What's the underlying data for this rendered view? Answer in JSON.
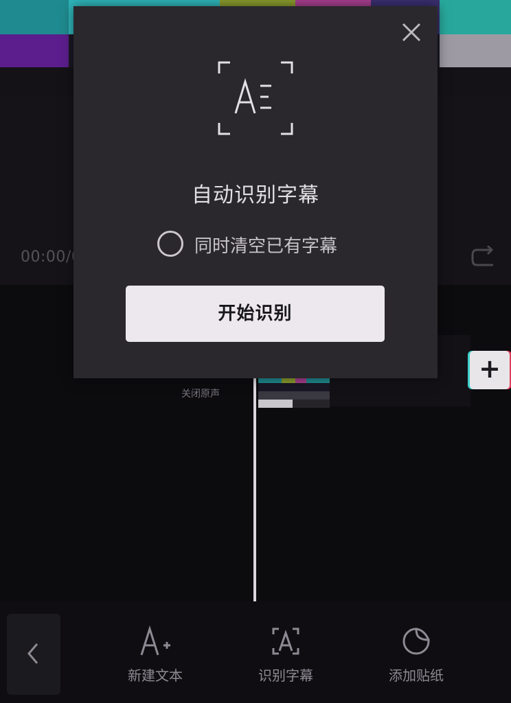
{
  "preview": {
    "time_code": "00:00/0"
  },
  "timeline": {
    "mute_label": "关闭原声",
    "add_clip_symbol": "+"
  },
  "toolbar": {
    "back_icon": "chevron-left-icon",
    "tools": [
      {
        "label": "新建文本",
        "icon": "add-text-icon"
      },
      {
        "label": "识别字幕",
        "icon": "recognize-captions-icon"
      },
      {
        "label": "添加贴纸",
        "icon": "sticker-icon"
      }
    ]
  },
  "dialog": {
    "title": "自动识别字幕",
    "clear_option_label": "同时清空已有字幕",
    "clear_option_checked": false,
    "start_button_label": "开始识别",
    "close_icon": "close-icon",
    "graphic_icon": "caption-recognition-icon"
  },
  "colors": {
    "dialog_bg": "#2a282c",
    "primary_button_bg": "#ece8ed",
    "page_bg": "#0d0b0f",
    "accent_cyan": "#3bd0c9",
    "accent_red": "#e03c59"
  }
}
